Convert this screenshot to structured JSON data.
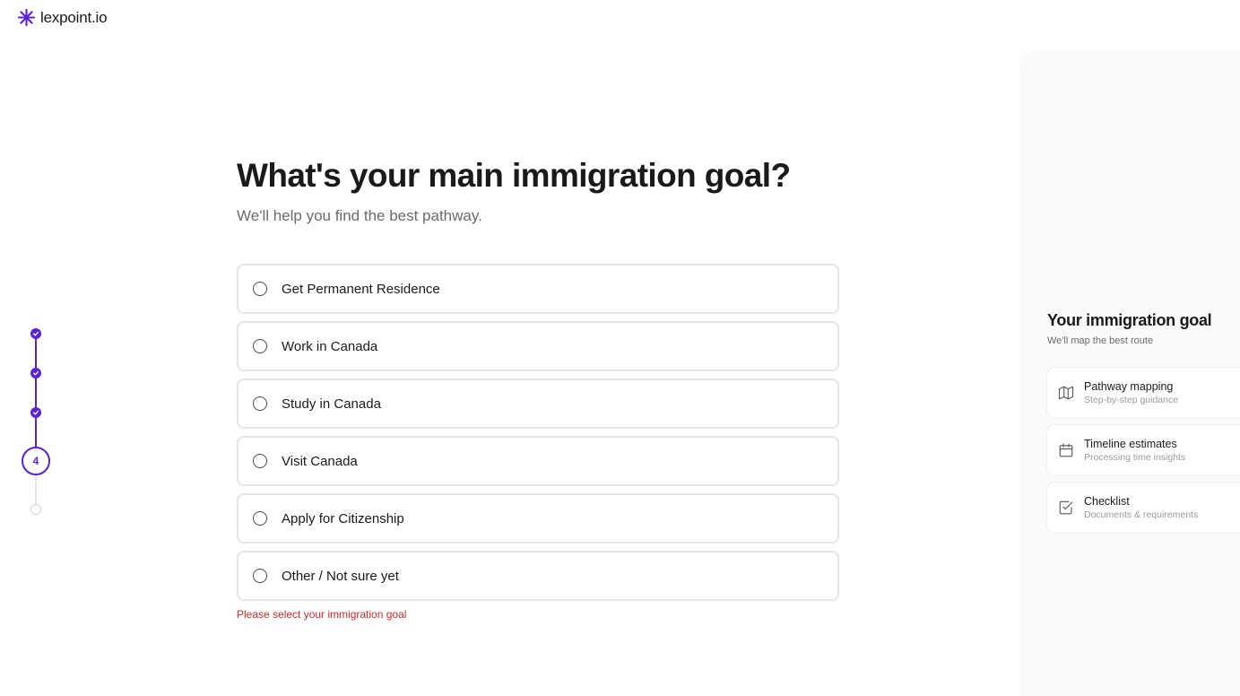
{
  "brand": {
    "name": "lexpoint.io",
    "color": "#5b21d6"
  },
  "stepper": {
    "current_step": "4"
  },
  "question": {
    "title": "What's your main immigration goal?",
    "subtitle": "We'll help you find the best pathway.",
    "options": [
      {
        "label": "Get Permanent Residence"
      },
      {
        "label": "Work in Canada"
      },
      {
        "label": "Study in Canada"
      },
      {
        "label": "Visit Canada"
      },
      {
        "label": "Apply for Citizenship"
      },
      {
        "label": "Other / Not sure yet"
      }
    ],
    "error": "Please select your immigration goal"
  },
  "panel": {
    "title": "Your immigration goal",
    "subtitle": "We'll map the best route",
    "features": [
      {
        "icon": "map-icon",
        "title": "Pathway mapping",
        "desc": "Step-by-step guidance"
      },
      {
        "icon": "calendar-icon",
        "title": "Timeline estimates",
        "desc": "Processing time insights"
      },
      {
        "icon": "checklist-icon",
        "title": "Checklist",
        "desc": "Documents & requirements"
      }
    ]
  }
}
